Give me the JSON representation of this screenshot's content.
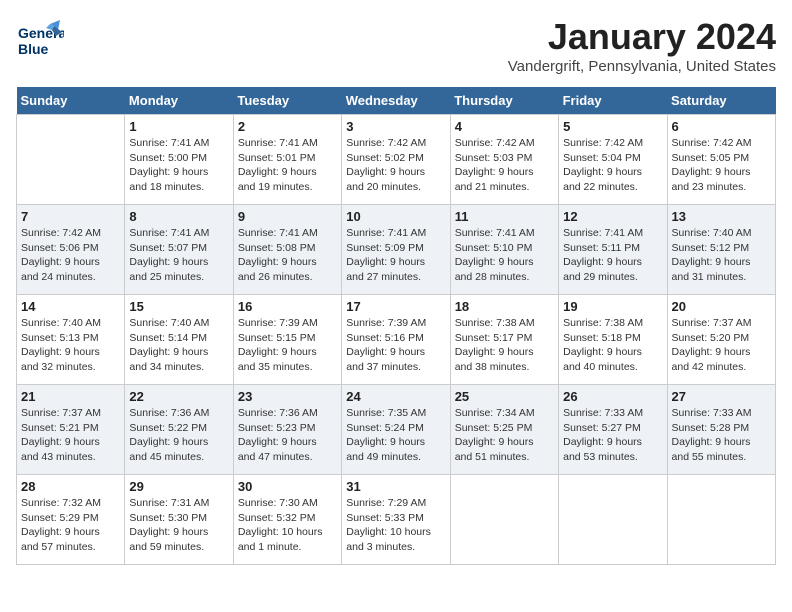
{
  "header": {
    "logo_line1": "General",
    "logo_line2": "Blue",
    "month_title": "January 2024",
    "location": "Vandergrift, Pennsylvania, United States"
  },
  "columns": [
    "Sunday",
    "Monday",
    "Tuesday",
    "Wednesday",
    "Thursday",
    "Friday",
    "Saturday"
  ],
  "weeks": [
    [
      {
        "day": "",
        "info": ""
      },
      {
        "day": "1",
        "info": "Sunrise: 7:41 AM\nSunset: 5:00 PM\nDaylight: 9 hours\nand 18 minutes."
      },
      {
        "day": "2",
        "info": "Sunrise: 7:41 AM\nSunset: 5:01 PM\nDaylight: 9 hours\nand 19 minutes."
      },
      {
        "day": "3",
        "info": "Sunrise: 7:42 AM\nSunset: 5:02 PM\nDaylight: 9 hours\nand 20 minutes."
      },
      {
        "day": "4",
        "info": "Sunrise: 7:42 AM\nSunset: 5:03 PM\nDaylight: 9 hours\nand 21 minutes."
      },
      {
        "day": "5",
        "info": "Sunrise: 7:42 AM\nSunset: 5:04 PM\nDaylight: 9 hours\nand 22 minutes."
      },
      {
        "day": "6",
        "info": "Sunrise: 7:42 AM\nSunset: 5:05 PM\nDaylight: 9 hours\nand 23 minutes."
      }
    ],
    [
      {
        "day": "7",
        "info": "Sunrise: 7:42 AM\nSunset: 5:06 PM\nDaylight: 9 hours\nand 24 minutes."
      },
      {
        "day": "8",
        "info": "Sunrise: 7:41 AM\nSunset: 5:07 PM\nDaylight: 9 hours\nand 25 minutes."
      },
      {
        "day": "9",
        "info": "Sunrise: 7:41 AM\nSunset: 5:08 PM\nDaylight: 9 hours\nand 26 minutes."
      },
      {
        "day": "10",
        "info": "Sunrise: 7:41 AM\nSunset: 5:09 PM\nDaylight: 9 hours\nand 27 minutes."
      },
      {
        "day": "11",
        "info": "Sunrise: 7:41 AM\nSunset: 5:10 PM\nDaylight: 9 hours\nand 28 minutes."
      },
      {
        "day": "12",
        "info": "Sunrise: 7:41 AM\nSunset: 5:11 PM\nDaylight: 9 hours\nand 29 minutes."
      },
      {
        "day": "13",
        "info": "Sunrise: 7:40 AM\nSunset: 5:12 PM\nDaylight: 9 hours\nand 31 minutes."
      }
    ],
    [
      {
        "day": "14",
        "info": "Sunrise: 7:40 AM\nSunset: 5:13 PM\nDaylight: 9 hours\nand 32 minutes."
      },
      {
        "day": "15",
        "info": "Sunrise: 7:40 AM\nSunset: 5:14 PM\nDaylight: 9 hours\nand 34 minutes."
      },
      {
        "day": "16",
        "info": "Sunrise: 7:39 AM\nSunset: 5:15 PM\nDaylight: 9 hours\nand 35 minutes."
      },
      {
        "day": "17",
        "info": "Sunrise: 7:39 AM\nSunset: 5:16 PM\nDaylight: 9 hours\nand 37 minutes."
      },
      {
        "day": "18",
        "info": "Sunrise: 7:38 AM\nSunset: 5:17 PM\nDaylight: 9 hours\nand 38 minutes."
      },
      {
        "day": "19",
        "info": "Sunrise: 7:38 AM\nSunset: 5:18 PM\nDaylight: 9 hours\nand 40 minutes."
      },
      {
        "day": "20",
        "info": "Sunrise: 7:37 AM\nSunset: 5:20 PM\nDaylight: 9 hours\nand 42 minutes."
      }
    ],
    [
      {
        "day": "21",
        "info": "Sunrise: 7:37 AM\nSunset: 5:21 PM\nDaylight: 9 hours\nand 43 minutes."
      },
      {
        "day": "22",
        "info": "Sunrise: 7:36 AM\nSunset: 5:22 PM\nDaylight: 9 hours\nand 45 minutes."
      },
      {
        "day": "23",
        "info": "Sunrise: 7:36 AM\nSunset: 5:23 PM\nDaylight: 9 hours\nand 47 minutes."
      },
      {
        "day": "24",
        "info": "Sunrise: 7:35 AM\nSunset: 5:24 PM\nDaylight: 9 hours\nand 49 minutes."
      },
      {
        "day": "25",
        "info": "Sunrise: 7:34 AM\nSunset: 5:25 PM\nDaylight: 9 hours\nand 51 minutes."
      },
      {
        "day": "26",
        "info": "Sunrise: 7:33 AM\nSunset: 5:27 PM\nDaylight: 9 hours\nand 53 minutes."
      },
      {
        "day": "27",
        "info": "Sunrise: 7:33 AM\nSunset: 5:28 PM\nDaylight: 9 hours\nand 55 minutes."
      }
    ],
    [
      {
        "day": "28",
        "info": "Sunrise: 7:32 AM\nSunset: 5:29 PM\nDaylight: 9 hours\nand 57 minutes."
      },
      {
        "day": "29",
        "info": "Sunrise: 7:31 AM\nSunset: 5:30 PM\nDaylight: 9 hours\nand 59 minutes."
      },
      {
        "day": "30",
        "info": "Sunrise: 7:30 AM\nSunset: 5:32 PM\nDaylight: 10 hours\nand 1 minute."
      },
      {
        "day": "31",
        "info": "Sunrise: 7:29 AM\nSunset: 5:33 PM\nDaylight: 10 hours\nand 3 minutes."
      },
      {
        "day": "",
        "info": ""
      },
      {
        "day": "",
        "info": ""
      },
      {
        "day": "",
        "info": ""
      }
    ]
  ]
}
